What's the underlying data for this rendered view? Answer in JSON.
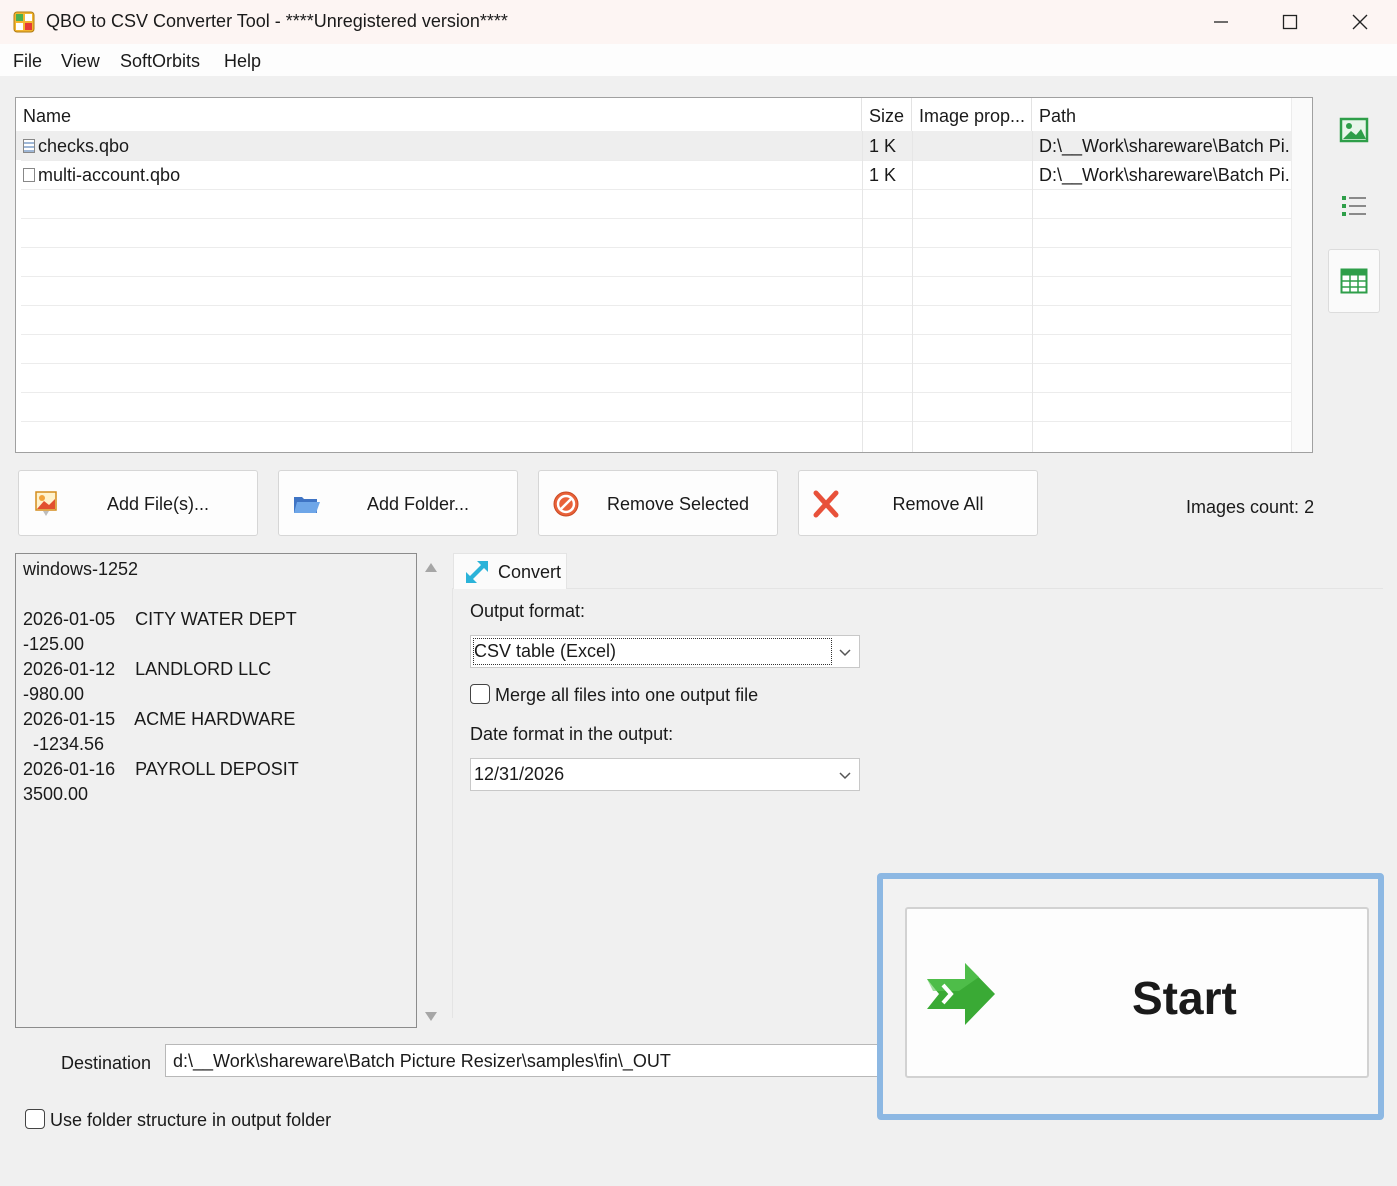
{
  "window": {
    "title": "QBO to CSV Converter Tool - ****Unregistered version****"
  },
  "menu": {
    "file": "File",
    "view": "View",
    "softorbits": "SoftOrbits",
    "help": "Help"
  },
  "file_list": {
    "columns": [
      "Name",
      "Size",
      "Image prop...",
      "Path"
    ],
    "rows": [
      {
        "name": "checks.qbo",
        "size": "1 K",
        "props": "",
        "path": "D:\\__Work\\shareware\\Batch Pi..."
      },
      {
        "name": "multi-account.qbo",
        "size": "1 K",
        "props": "",
        "path": "D:\\__Work\\shareware\\Batch Pi..."
      }
    ]
  },
  "buttons": {
    "add_files": "Add File(s)...",
    "add_folder": "Add Folder...",
    "remove_selected": "Remove Selected",
    "remove_all": "Remove All"
  },
  "images_count": "Images count: 2",
  "preview": {
    "encoding": "windows-1252",
    "lines": [
      "2026-01-05    CITY WATER DEPT",
      "-125.00",
      "2026-01-12    LANDLORD LLC",
      "-980.00",
      "2026-01-15    ACME HARDWARE",
      "  -1234.56",
      "2026-01-16    PAYROLL DEPOSIT",
      "3500.00"
    ]
  },
  "convert_tab": {
    "label": "Convert",
    "output_format_label": "Output format:",
    "output_format_value": "CSV table (Excel)",
    "merge_label": "Merge all files into one output file",
    "merge_checked": false,
    "date_format_label": "Date format in the output:",
    "date_format_value": "12/31/2026"
  },
  "destination": {
    "label": "Destination",
    "value": "d:\\__Work\\shareware\\Batch Picture Resizer\\samples\\fin\\_OUT"
  },
  "use_folder_structure": {
    "label": "Use folder structure in output folder",
    "checked": false
  },
  "start": {
    "label": "Start"
  },
  "colors": {
    "accent_frame": "#8db8e3",
    "start_arrow": "#3aaa35",
    "remove_all_x": "#e8513a"
  }
}
